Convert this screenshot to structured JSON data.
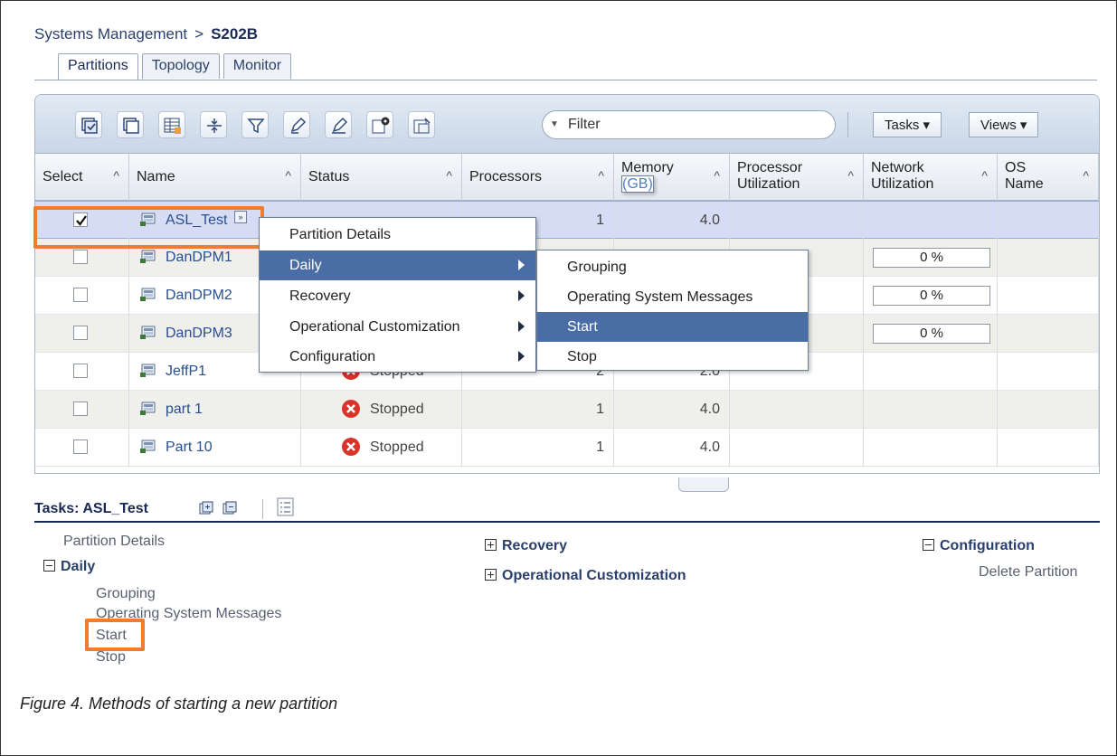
{
  "breadcrumb": {
    "root": "Systems Management",
    "separator": ">",
    "current": "S202B"
  },
  "tabs": [
    {
      "label": "Partitions"
    },
    {
      "label": "Topology"
    },
    {
      "label": "Monitor"
    }
  ],
  "toolbar": {
    "filter_placeholder": "Filter",
    "tasks_label": "Tasks ▾",
    "views_label": "Views ▾",
    "icons": [
      "select-all-icon",
      "deselect-all-icon",
      "table-edit-icon",
      "expand-icon",
      "filter-icon",
      "edit-icon",
      "clear-icon",
      "configure-columns-icon",
      "details-icon"
    ]
  },
  "columns": [
    {
      "label": "Select",
      "sub": ""
    },
    {
      "label": "Name",
      "sub": ""
    },
    {
      "label": "Status",
      "sub": ""
    },
    {
      "label": "Processors",
      "sub": ""
    },
    {
      "label": "Memory",
      "sub": "(GB)"
    },
    {
      "label": "Processor",
      "sub": "Utilization"
    },
    {
      "label": "Network",
      "sub": "Utilization"
    },
    {
      "label": "OS",
      "sub": "Name"
    }
  ],
  "rows": [
    {
      "name": "ASL_Test",
      "status": "",
      "processors": "1",
      "memory": "4.0",
      "net": "",
      "checked": true
    },
    {
      "name": "DanDPM1",
      "status": "",
      "processors": "",
      "memory": "",
      "net": "0 %",
      "checked": false
    },
    {
      "name": "DanDPM2",
      "status": "",
      "processors": "",
      "memory": "",
      "net": "0 %",
      "checked": false
    },
    {
      "name": "DanDPM3",
      "status": "",
      "processors": "",
      "memory": "",
      "net": "0 %",
      "checked": false
    },
    {
      "name": "JeffP1",
      "status": "Stopped",
      "processors": "2",
      "memory": "2.0",
      "net": "",
      "checked": false
    },
    {
      "name": "part 1",
      "status": "Stopped",
      "processors": "1",
      "memory": "4.0",
      "net": "",
      "checked": false
    },
    {
      "name": "Part 10",
      "status": "Stopped",
      "processors": "1",
      "memory": "4.0",
      "net": "",
      "checked": false
    }
  ],
  "context_menu": {
    "items": [
      {
        "label": "Partition Details"
      },
      {
        "label": "Daily"
      },
      {
        "label": "Recovery"
      },
      {
        "label": "Operational Customization"
      },
      {
        "label": "Configuration"
      }
    ],
    "submenu": [
      {
        "label": "Grouping"
      },
      {
        "label": "Operating System Messages"
      },
      {
        "label": "Start"
      },
      {
        "label": "Stop"
      }
    ]
  },
  "tasks": {
    "title": "Tasks: ASL_Test",
    "partition_details": "Partition Details",
    "daily": {
      "label": "Daily",
      "items": [
        "Grouping",
        "Operating System Messages",
        "Start",
        "Stop"
      ]
    },
    "recovery": "Recovery",
    "operational_customization": "Operational Customization",
    "configuration": {
      "label": "Configuration",
      "items": [
        "Delete Partition"
      ]
    }
  },
  "caption": "Figure 4. Methods of starting a new partition",
  "colors": {
    "highlight": "#f07d2d",
    "menu_selected": "#4a6da6",
    "row_selected": "#d5dcf3"
  }
}
